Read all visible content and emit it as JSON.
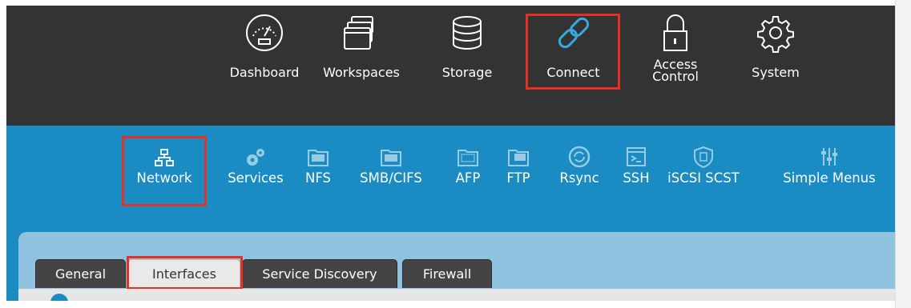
{
  "top_nav": {
    "items": [
      {
        "label": "Dashboard",
        "icon": "gauge-icon"
      },
      {
        "label": "Workspaces",
        "icon": "windows-icon"
      },
      {
        "label": "Storage",
        "icon": "database-icon"
      },
      {
        "label": "Connect",
        "icon": "link-icon",
        "selected": true
      },
      {
        "label": "Access\nControl",
        "icon": "lock-icon"
      },
      {
        "label": "System",
        "icon": "gear-icon"
      }
    ]
  },
  "sub_nav": {
    "items": [
      {
        "label": "Network",
        "icon": "network-icon",
        "selected": true
      },
      {
        "label": "Services",
        "icon": "gears-icon"
      },
      {
        "label": "NFS",
        "icon": "nfs-folder-icon",
        "badge": "NFS"
      },
      {
        "label": "SMB/CIFS",
        "icon": "smb-folder-icon",
        "badge": "SMB"
      },
      {
        "label": "AFP",
        "icon": "afp-folder-icon",
        "badge": "Apple"
      },
      {
        "label": "FTP",
        "icon": "ftp-folder-icon",
        "badge": "FTP"
      },
      {
        "label": "Rsync",
        "icon": "sync-icon"
      },
      {
        "label": "SSH",
        "icon": "terminal-icon"
      },
      {
        "label": "iSCSI SCST",
        "icon": "shield-icon"
      },
      {
        "label": "Simple Menus",
        "icon": "sliders-icon"
      }
    ]
  },
  "tabs": [
    {
      "label": "General"
    },
    {
      "label": "Interfaces",
      "active": true
    },
    {
      "label": "Service Discovery"
    },
    {
      "label": "Firewall"
    }
  ],
  "colors": {
    "top_bar": "#333333",
    "sub_bar": "#1a8cc3",
    "panel": "#8fc3df",
    "highlight": "#e63023",
    "connect_icon": "#35a9e0"
  }
}
